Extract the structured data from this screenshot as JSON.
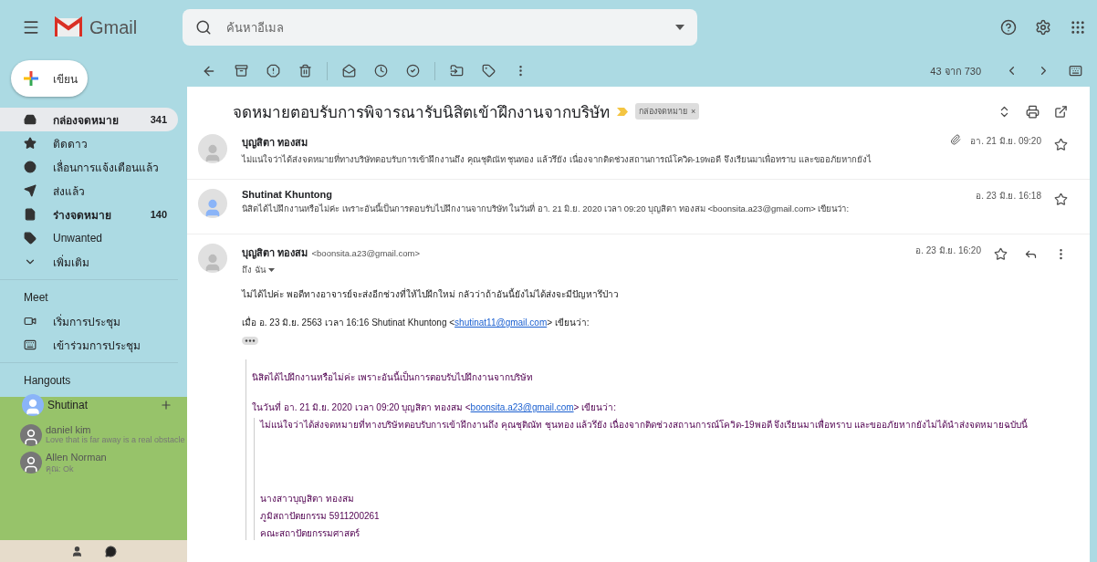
{
  "header": {
    "app_name": "Gmail",
    "search": {
      "placeholder": "ค้นหาอีเมล"
    }
  },
  "compose": {
    "label": "เขียน"
  },
  "sidebar": {
    "items": [
      {
        "label": "กล่องจดหมาย",
        "count": "341",
        "selected": true,
        "unread": true
      },
      {
        "label": "ติดดาว",
        "selected": false,
        "unread": false
      },
      {
        "label": "เลื่อนการแจ้งเตือนแล้ว",
        "selected": false,
        "unread": false
      },
      {
        "label": "ส่งแล้ว",
        "selected": false,
        "unread": false
      },
      {
        "label": "ร่างจดหมาย",
        "count": "140",
        "selected": false,
        "unread": true
      },
      {
        "label": "Unwanted",
        "selected": false,
        "unread": false
      },
      {
        "label": "เพิ่มเติม",
        "selected": false,
        "unread": false
      }
    ],
    "meet": {
      "title": "Meet",
      "items": [
        "เริ่มการประชุม",
        "เข้าร่วมการประชุม"
      ]
    },
    "hangouts": {
      "title": "Hangouts",
      "user": "Shutinat",
      "chats": [
        {
          "name": "daniel kim",
          "message": "Love that is far away is a real obstacle"
        },
        {
          "name": "Allen Norman",
          "message": "คุณ: Ok"
        }
      ]
    }
  },
  "toolbar": {
    "pagination": "43 จาก 730"
  },
  "thread": {
    "subject": "จดหมายตอบรับการพิจารณารับนิสิตเข้าฝึกงานจากบริษัท",
    "label": "กล่องจดหมาย",
    "label_close": "×",
    "collapsed": [
      {
        "sender": "บุญสิตา ทองสม",
        "snippet": "ไม่แน่ใจว่าได้ส่งจดหมายที่ทางบริษัทตอบรับการเข้าฝึกงานถึง คุณชุติณัท ชุนทอง แล้วรึยัง เนื่องจากติดช่วงสถานการณ์โควิด-19พอดี จึงเรียนมาเพื่อทราบ และขออภัยหากยังไ",
        "date": "อา. 21 มิ.ย. 09:20",
        "attachment": true,
        "starred": false
      },
      {
        "sender": "Shutinat Khuntong",
        "snippet": "นิสิตได้ไปฝึกงานหรือไม่ค่ะ เพราะอันนี้เป็นการตอบรับไปฝึกงานจากบริษัท ในวันที่ อา. 21 มิ.ย. 2020 เวลา 09:20 บุญสิตา ทองสม <boonsita.a23@gmail.com> เขียนว่า:",
        "date": "อ. 23 มิ.ย. 16:18",
        "attachment": false,
        "starred": false
      }
    ],
    "open": {
      "sender": "บุญสิตา ทองสม",
      "email": "<boonsita.a23@gmail.com>",
      "to": "ถึง ฉัน",
      "date": "อ. 23 มิ.ย. 16:20",
      "starred": false,
      "body": "ไม่ได้ไปค่ะ พอดีทางอาจารย์จะส่งอีกช่วงที่ให้ไปฝึกใหม่ กลัวว่าถ้าอันนี้ยังไม่ได้ส่งจะมีปัญหารึป่าว",
      "reply_header": {
        "before": "เมื่อ อ. 23 มิ.ย. 2563 เวลา 16:16 Shutinat Khuntong <",
        "link": "shutinat11@gmail.com",
        "after": "> เขียนว่า:"
      },
      "quote": {
        "text": "นิสิตได้ไปฝึกงานหรือไม่ค่ะ  เพราะอันนี้เป็นการตอบรับไปฝึกงานจากบริษัท",
        "reply_header": {
          "before": "ในวันที่ อา. 21 มิ.ย. 2020 เวลา 09:20 บุญสิตา ทองสม <",
          "link": "boonsita.a23@gmail.com",
          "after": "> เขียนว่า:"
        },
        "nested": "ไม่แน่ใจว่าได้ส่งจดหมายที่ทางบริษัทตอบรับการเข้าฝึกงานถึง คุณชุติณัท ชุนทอง แล้วรึยัง เนื่องจากติดช่วงสถานการณ์โควิด-19พอดี จึงเรียนมาเพื่อทราบ และขออภัยหากยังไม่ได้นำส่งจดหมายฉบับนี้",
        "signature": [
          "นางสาวบุญสิตา ทองสม",
          "ภูมิสถาปัตยกรรม 5911200261",
          "คณะสถาปัตยกรรมศาสตร์"
        ]
      }
    }
  }
}
